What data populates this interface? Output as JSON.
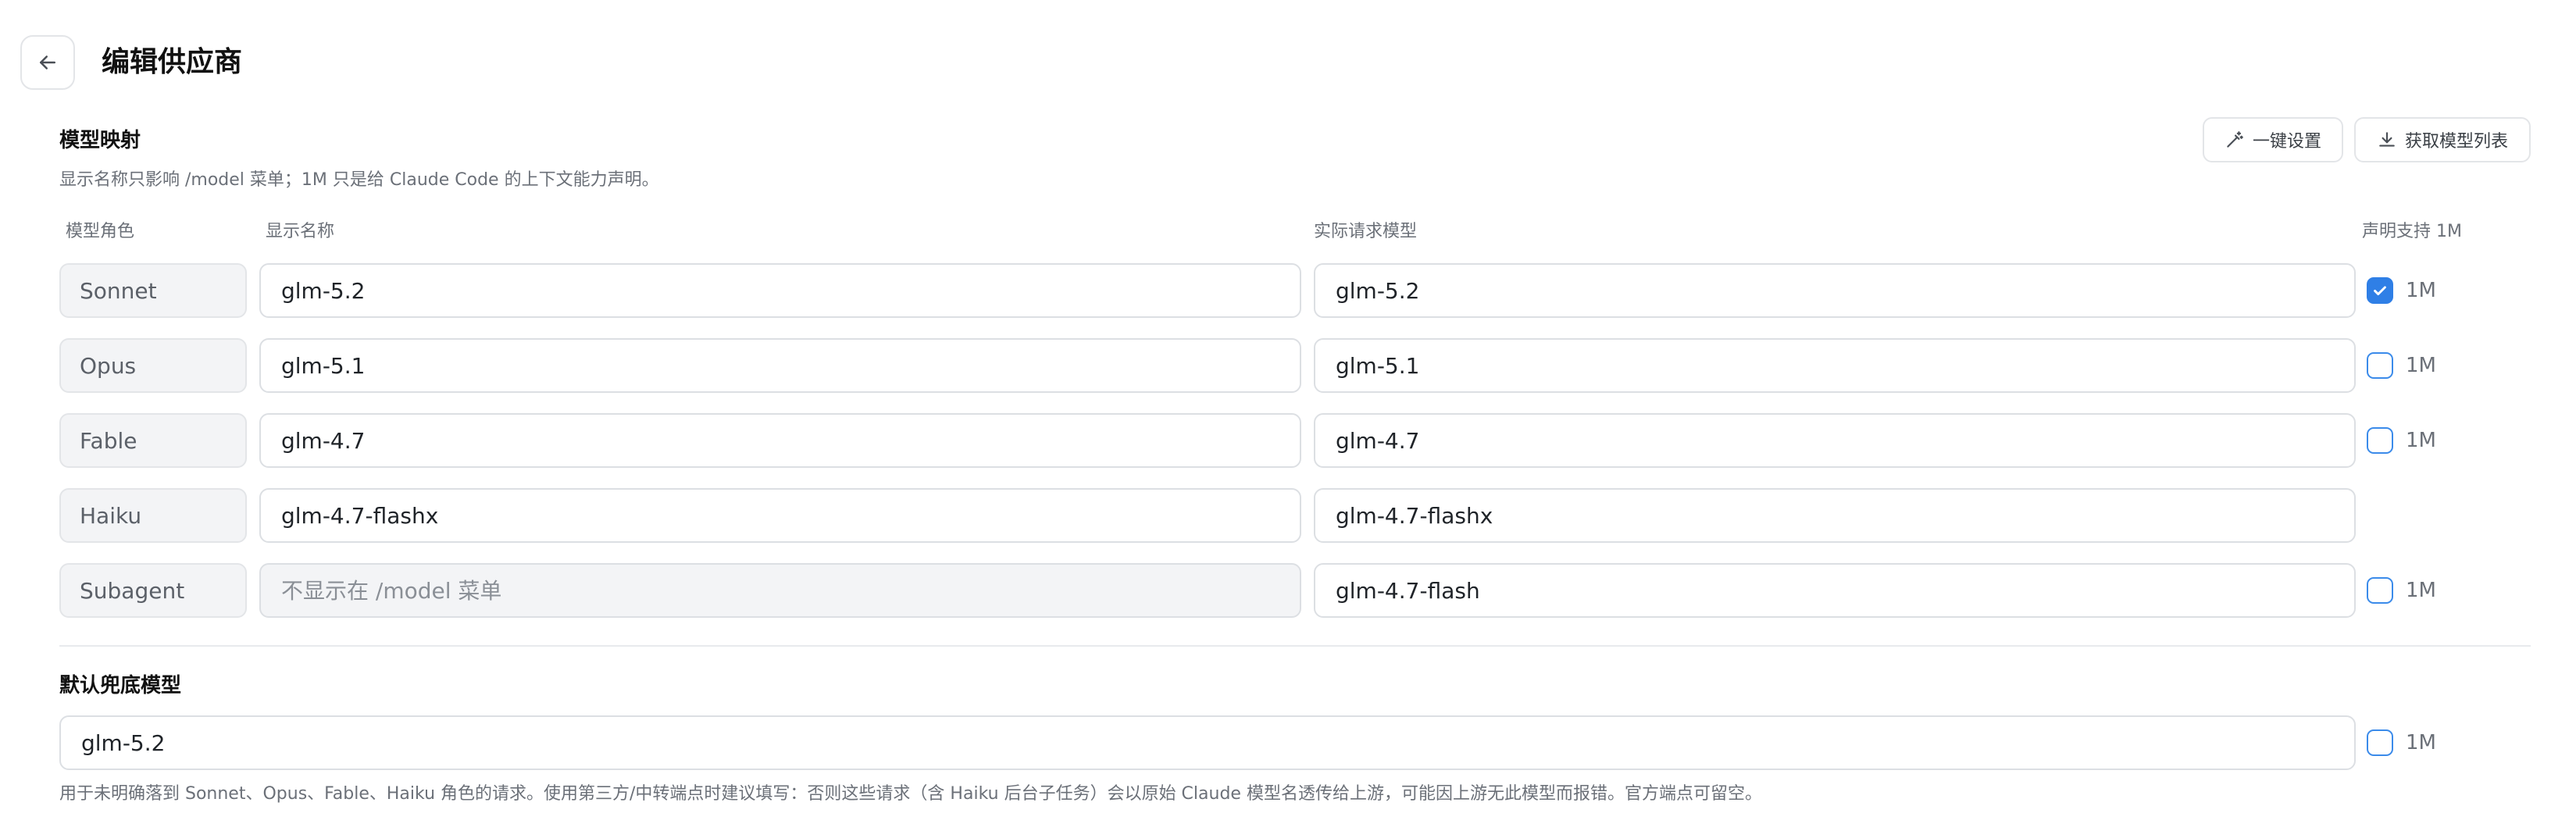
{
  "header": {
    "title": "编辑供应商"
  },
  "mapping": {
    "title": "模型映射",
    "description": "显示名称只影响 /model 菜单；1M 只是给 Claude Code 的上下文能力声明。",
    "buttons": {
      "one_click": "一键设置",
      "fetch_list": "获取模型列表"
    },
    "columns": {
      "role": "模型角色",
      "display_name": "显示名称",
      "actual_model": "实际请求模型",
      "declare_1m": "声明支持 1M"
    },
    "rows": [
      {
        "role": "Sonnet",
        "display": "glm-5.2",
        "actual": "glm-5.2",
        "has_1m": true,
        "checked": true,
        "label_1m": "1M"
      },
      {
        "role": "Opus",
        "display": "glm-5.1",
        "actual": "glm-5.1",
        "has_1m": true,
        "checked": false,
        "label_1m": "1M"
      },
      {
        "role": "Fable",
        "display": "glm-4.7",
        "actual": "glm-4.7",
        "has_1m": true,
        "checked": false,
        "label_1m": "1M"
      },
      {
        "role": "Haiku",
        "display": "glm-4.7-flashx",
        "actual": "glm-4.7-flashx",
        "has_1m": false,
        "checked": false,
        "label_1m": ""
      },
      {
        "role": "Subagent",
        "display": "",
        "display_placeholder": "不显示在 /model 菜单",
        "actual": "glm-4.7-flash",
        "has_1m": true,
        "checked": false,
        "label_1m": "1M"
      }
    ]
  },
  "fallback": {
    "title": "默认兜底模型",
    "value": "glm-5.2",
    "checked": false,
    "label_1m": "1M",
    "help": "用于未明确落到 Sonnet、Opus、Fable、Haiku 角色的请求。使用第三方/中转端点时建议填写：否则这些请求（含 Haiku 后台子任务）会以原始 Claude 模型名透传给上游，可能因上游无此模型而报错。官方端点可留空。"
  },
  "icons": {
    "back": "arrow-left-icon",
    "one_click": "magic-wand-icon",
    "fetch": "download-icon",
    "check": "check-icon"
  },
  "colors": {
    "accent": "#2f7fe6",
    "border": "#dcdfe3",
    "muted_text": "#6b7078"
  }
}
